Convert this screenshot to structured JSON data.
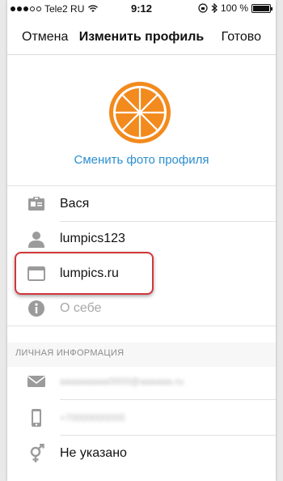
{
  "status_bar": {
    "carrier": "Tele2 RU",
    "time": "9:12",
    "battery_percent": "100 %"
  },
  "nav": {
    "cancel_label": "Отмена",
    "title": "Изменить профиль",
    "done_label": "Готово"
  },
  "profile": {
    "change_photo_label": "Сменить фото профиля",
    "name": "Вася",
    "username": "lumpics123",
    "website": "lumpics.ru",
    "bio_placeholder": "О себе"
  },
  "private_section": {
    "header": "ЛИЧНАЯ ИНФОРМАЦИЯ",
    "email_masked": "aaaaaaaaa0000@aaaaaa.ru",
    "phone_masked": "+70000000000",
    "gender": "Не указано"
  },
  "colors": {
    "accent_link": "#2b8ecf",
    "highlight_border": "#d2373c",
    "icon_gray": "#9b9b9b",
    "orange": "#f28a1e"
  },
  "icons": [
    "signal-dots",
    "wifi-icon",
    "lock-rotation-icon",
    "bluetooth-icon",
    "battery-icon",
    "id-card-icon",
    "person-icon",
    "browser-window-icon",
    "info-icon",
    "envelope-icon",
    "phone-icon",
    "gender-icon"
  ]
}
